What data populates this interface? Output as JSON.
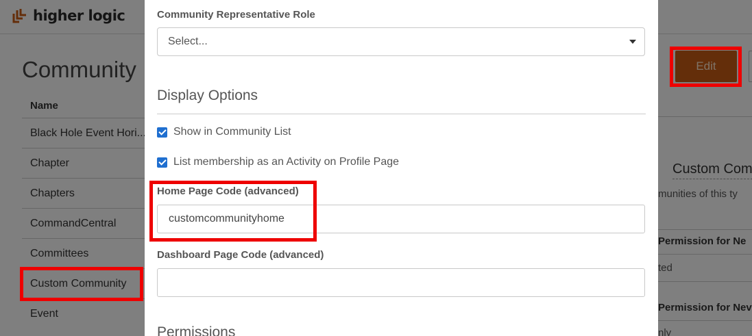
{
  "header": {
    "brand": "higher logic"
  },
  "page": {
    "title": "Community",
    "name_header": "Name",
    "community_types": [
      "Black Hole Event Hori...",
      "Chapter",
      "Chapters",
      "CommandCentral",
      "Committees",
      "Custom Community",
      "Event"
    ],
    "selected_type": "Custom Community",
    "edit_label": "Edit"
  },
  "detail": {
    "heading": "Custom Com",
    "description": "munities of this ty",
    "permission_1": "Permission for Ne",
    "value_1": "ted",
    "permission_2": "Permission for Nev",
    "value_2": "nly"
  },
  "modal": {
    "rep_role_label": "Community Representative Role",
    "rep_role_value": "Select...",
    "display_options_title": "Display Options",
    "show_in_list_label": "Show in Community List",
    "show_in_list_checked": true,
    "list_membership_label": "List membership as an Activity on Profile Page",
    "list_membership_checked": true,
    "home_page_code_label": "Home Page Code",
    "home_page_code_adv": "(advanced)",
    "home_page_code_value": "customcommunityhome",
    "dashboard_code_label": "Dashboard Page Code",
    "dashboard_code_adv": "(advanced)",
    "dashboard_code_value": "",
    "permissions_title": "Permissions"
  },
  "colors": {
    "accent": "#c85d14",
    "checkbox": "#1f6fd0",
    "highlight": "#ee0000"
  }
}
